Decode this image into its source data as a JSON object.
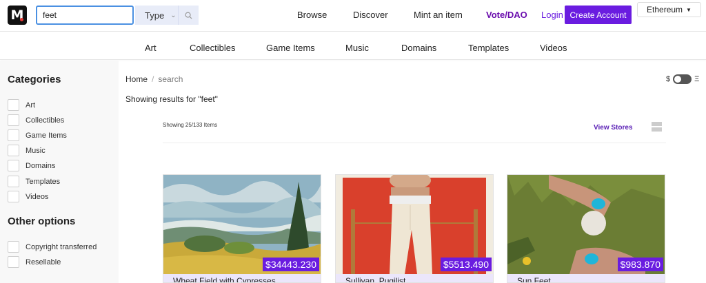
{
  "logo": "M",
  "search": {
    "value": "feet",
    "type_label": "Type"
  },
  "nav": {
    "browse": "Browse",
    "discover": "Discover",
    "mint": "Mint an item",
    "vote": "Vote/DAO"
  },
  "auth": {
    "login": "Login",
    "create": "Create Account"
  },
  "network": "Ethereum",
  "categories_bar": [
    "Art",
    "Collectibles",
    "Game Items",
    "Music",
    "Domains",
    "Templates",
    "Videos"
  ],
  "sidebar": {
    "categories_title": "Categories",
    "categories": [
      "Art",
      "Collectibles",
      "Game Items",
      "Music",
      "Domains",
      "Templates",
      "Videos"
    ],
    "other_title": "Other options",
    "other": [
      "Copyright transferred",
      "Resellable"
    ]
  },
  "breadcrumb": {
    "home": "Home",
    "current": "search"
  },
  "currency_toggle": {
    "left": "$",
    "right": "Ξ"
  },
  "results_for": "Showing results for \"feet\"",
  "showing": "Showing 25/133 Items",
  "view_stores": "View Stores",
  "cards": [
    {
      "title": "Wheat Field with Cypresses",
      "price": "$34443.230"
    },
    {
      "title": "Sullivan, Pugilist",
      "price": "$5513.490"
    },
    {
      "title": "Sun Feet",
      "price": "$983.870"
    }
  ],
  "colors": {
    "accent": "#6a1ce0",
    "search_border": "#4a90e2"
  }
}
